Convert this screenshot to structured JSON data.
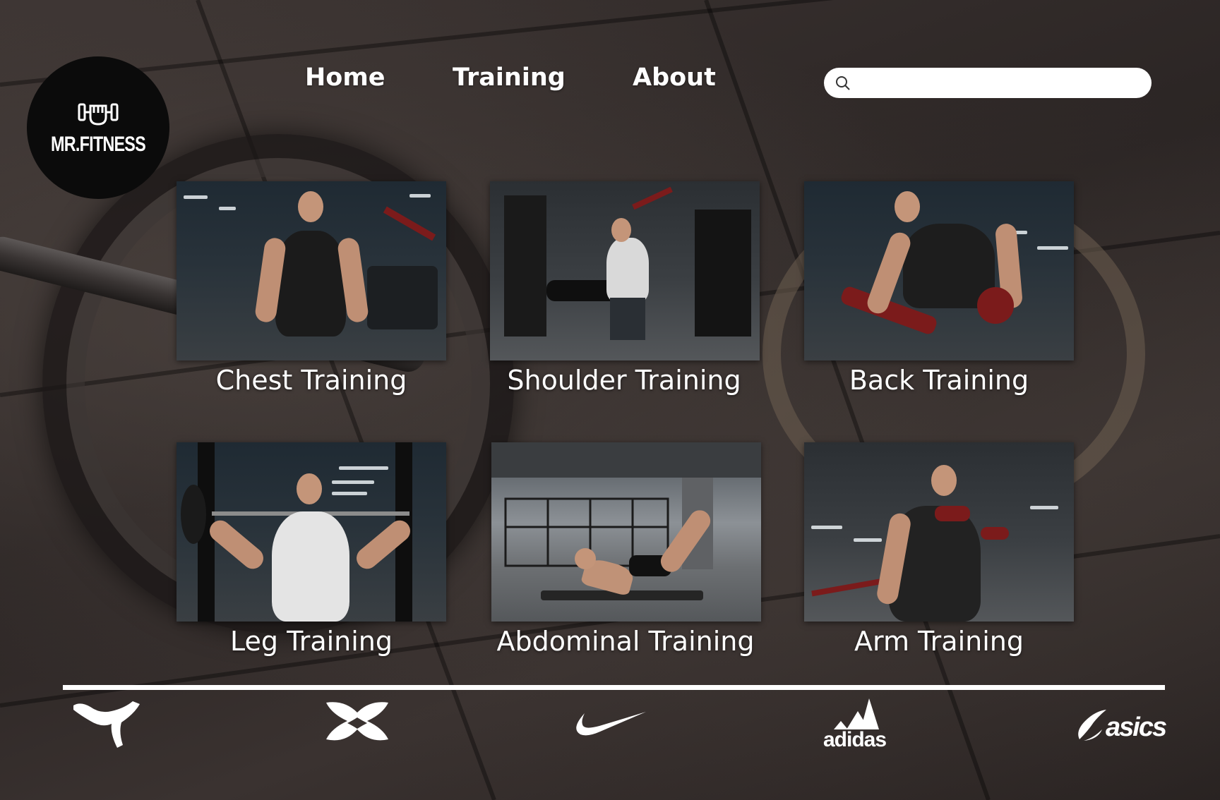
{
  "logo": {
    "text": "MR.FITNESS"
  },
  "nav": {
    "home": "Home",
    "training": "Training",
    "about": "About"
  },
  "search": {
    "value": "",
    "placeholder": ""
  },
  "cards": [
    {
      "label": "Chest Training"
    },
    {
      "label": "Shoulder Training"
    },
    {
      "label": "Back Training"
    },
    {
      "label": "Leg Training"
    },
    {
      "label": "Abdominal Training"
    },
    {
      "label": "Arm Training"
    }
  ],
  "brands": {
    "adidas": "adidas",
    "asics": "asics"
  }
}
